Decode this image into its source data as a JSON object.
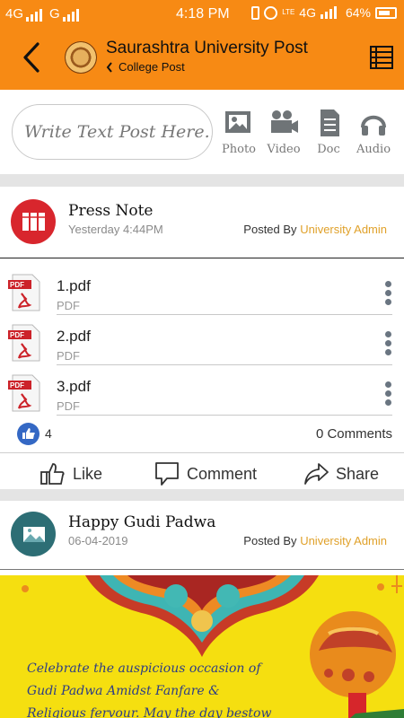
{
  "status_bar": {
    "left_network_1": "4G",
    "left_network_2": "G",
    "time": "4:18 PM",
    "right_network": "4G",
    "lte": "LTE",
    "battery_percent": "64%"
  },
  "header": {
    "title": "Saurashtra University Post",
    "subtitle": "College Post",
    "back_icon": "chevron-left-icon",
    "list_icon": "list-icon"
  },
  "composer": {
    "placeholder": "Write Text Post Here...",
    "tools": [
      {
        "label": "Photo",
        "icon": "photo-icon"
      },
      {
        "label": "Video",
        "icon": "video-camera-icon"
      },
      {
        "label": "Doc",
        "icon": "document-icon"
      },
      {
        "label": "Audio",
        "icon": "headphones-icon"
      }
    ]
  },
  "posts": [
    {
      "title": "Press Note",
      "time": "Yesterday 4:44PM",
      "posted_by_label": "Posted By",
      "author": "University Admin",
      "files": [
        {
          "name": "1.pdf",
          "type": "PDF"
        },
        {
          "name": "2.pdf",
          "type": "PDF"
        },
        {
          "name": "3.pdf",
          "type": "PDF"
        }
      ],
      "likes": "4",
      "comments": "0 Comments",
      "actions": {
        "like": "Like",
        "comment": "Comment",
        "share": "Share"
      }
    },
    {
      "title": "Happy Gudi Padwa",
      "time": "06-04-2019",
      "posted_by_label": "Posted By",
      "author": "University Admin",
      "banner_lines": [
        "Celebrate the auspicious occasion of",
        "Gudi Padwa Amidst Fanfare &",
        "Religious fervour. May the day bestow"
      ]
    }
  ],
  "colors": {
    "primary": "#f78a14",
    "author": "#e0a12a",
    "like_blue": "#3468c4",
    "press_avatar": "#d8262d",
    "gudi_avatar": "#2d6e75",
    "banner_yellow": "#f5df10"
  }
}
